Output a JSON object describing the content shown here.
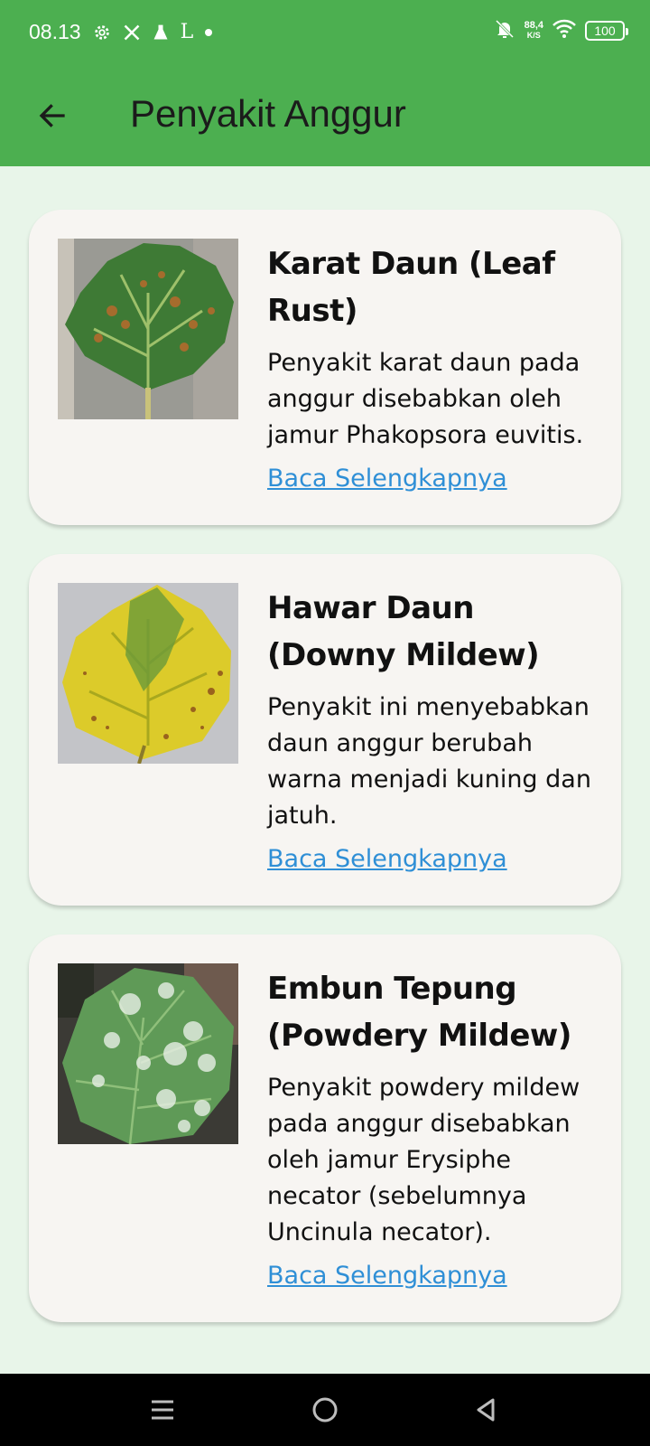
{
  "status_bar": {
    "time": "08.13",
    "icons": [
      "gear-icon",
      "x-icon",
      "flask-icon",
      "l-app-icon",
      "dot-icon"
    ],
    "net_speed_value": "88,4",
    "net_speed_unit": "K/S",
    "battery": "100",
    "right_icons": [
      "bell-off-icon",
      "wifi-icon",
      "battery-icon"
    ]
  },
  "app_bar": {
    "back_icon": "arrow-left-icon",
    "title": "Penyakit Anggur",
    "color": "#4caf50"
  },
  "cards": [
    {
      "title": "Karat Daun (Leaf Rust)",
      "description": "Penyakit karat daun pada anggur disebabkan oleh jamur Phakopsora euvitis.",
      "link": "Baca Selengkapnya",
      "image_icon": "leaf-rust-image"
    },
    {
      "title": "Hawar Daun (Downy Mildew)",
      "description": "Penyakit ini menyebabkan daun anggur berubah warna menjadi kuning dan jatuh.",
      "link": "Baca Selengkapnya",
      "image_icon": "downy-mildew-image"
    },
    {
      "title": "Embun Tepung (Powdery Mildew)",
      "description": "Penyakit powdery mildew pada anggur disebabkan oleh jamur Erysiphe necator (sebelumnya Uncinula necator).",
      "link": "Baca Selengkapnya",
      "image_icon": "powdery-mildew-image"
    }
  ],
  "nav_bar": {
    "icons": [
      "menu-icon",
      "home-icon",
      "back-triangle-icon"
    ]
  },
  "colors": {
    "accent": "#4caf50",
    "background": "#e8f5e9",
    "card": "#f7f5f2",
    "link": "#2f8fd6"
  }
}
